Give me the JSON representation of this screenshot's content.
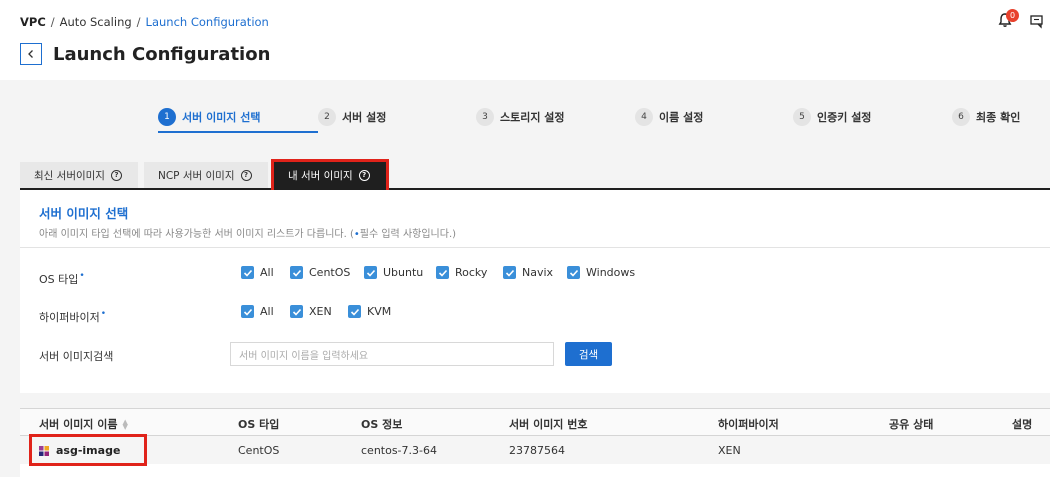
{
  "breadcrumb": {
    "root": "VPC",
    "mid": "Auto Scaling",
    "current": "Launch Configuration"
  },
  "page": {
    "title": "Launch Configuration"
  },
  "header": {
    "notification_count": "0"
  },
  "steps": [
    {
      "num": "1",
      "label": "서버 이미지 선택"
    },
    {
      "num": "2",
      "label": "서버 설정"
    },
    {
      "num": "3",
      "label": "스토리지 설정"
    },
    {
      "num": "4",
      "label": "이름 설정"
    },
    {
      "num": "5",
      "label": "인증키 설정"
    },
    {
      "num": "6",
      "label": "최종 확인"
    }
  ],
  "tabs": [
    {
      "label": "최신 서버이미지"
    },
    {
      "label": "NCP 서버 이미지"
    },
    {
      "label": "내 서버 이미지"
    }
  ],
  "panel": {
    "title": "서버 이미지 선택",
    "desc_before": "아래 이미지 타입 선택에 따라 사용가능한 서버 이미지 리스트가 다릅니다. (",
    "desc_dot": "•",
    "desc_after": "필수 입력 사항입니다.)"
  },
  "os_type": {
    "label": "OS 타입",
    "options": [
      "All",
      "CentOS",
      "Ubuntu",
      "Rocky",
      "Navix",
      "Windows"
    ]
  },
  "hypervisor": {
    "label": "하이퍼바이저",
    "options": [
      "All",
      "XEN",
      "KVM"
    ]
  },
  "search": {
    "label": "서버 이미지검색",
    "placeholder": "서버 이미지 이름을 입력하세요",
    "button": "검색"
  },
  "table": {
    "columns": [
      "서버 이미지 이름",
      "OS 타입",
      "OS 정보",
      "서버 이미지 번호",
      "하이퍼바이저",
      "공유 상태",
      "설명"
    ],
    "rows": [
      {
        "name": "asg-image",
        "os_type": "CentOS",
        "os_info": "centos-7.3-64",
        "image_no": "23787564",
        "hypervisor": "XEN",
        "share": "",
        "desc": ""
      }
    ]
  },
  "colors": {
    "accent": "#1e6fd0",
    "highlight": "#e0231a",
    "checkbox": "#3a8fd9"
  }
}
